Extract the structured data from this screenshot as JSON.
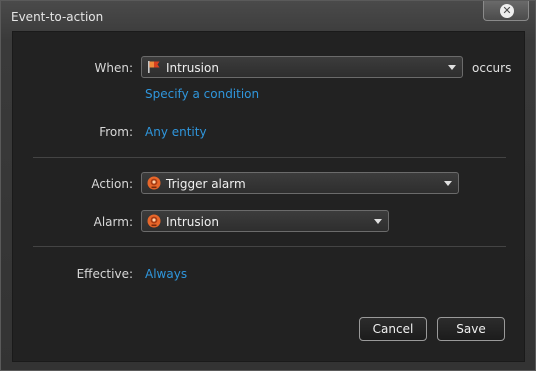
{
  "window": {
    "title": "Event-to-action",
    "close_symbol": "✕"
  },
  "form": {
    "when_label": "When:",
    "when_value": "Intrusion",
    "when_icon": "flag-icon",
    "occurs_text": "occurs",
    "condition_link": "Specify a condition",
    "from_label": "From:",
    "from_link": "Any entity",
    "action_label": "Action:",
    "action_value": "Trigger alarm",
    "action_icon": "alarm-icon",
    "alarm_label": "Alarm:",
    "alarm_value": "Intrusion",
    "alarm_icon": "alarm-icon",
    "effective_label": "Effective:",
    "effective_link": "Always"
  },
  "buttons": {
    "cancel": "Cancel",
    "save": "Save"
  },
  "colors": {
    "link": "#2f96dc",
    "alarm_orange": "#e8672a",
    "flag_red": "#d8401f"
  }
}
